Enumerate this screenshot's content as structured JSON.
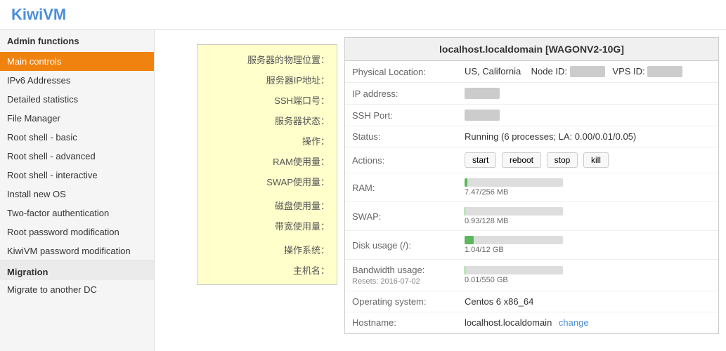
{
  "header": {
    "logo": "KiwiVM"
  },
  "sidebar": {
    "admin_functions_label": "Admin functions",
    "items": [
      {
        "id": "main-controls",
        "label": "Main controls",
        "active": true
      },
      {
        "id": "ipv6-addresses",
        "label": "IPv6 Addresses",
        "active": false
      },
      {
        "id": "detailed-statistics",
        "label": "Detailed statistics",
        "active": false
      },
      {
        "id": "file-manager",
        "label": "File Manager",
        "active": false
      },
      {
        "id": "root-shell-basic",
        "label": "Root shell - basic",
        "active": false
      },
      {
        "id": "root-shell-advanced",
        "label": "Root shell - advanced",
        "active": false
      },
      {
        "id": "root-shell-interactive",
        "label": "Root shell - interactive",
        "active": false
      },
      {
        "id": "install-new-os",
        "label": "Install new OS",
        "active": false
      },
      {
        "id": "two-factor-auth",
        "label": "Two-factor authentication",
        "active": false
      },
      {
        "id": "root-password-mod",
        "label": "Root password modification",
        "active": false
      },
      {
        "id": "kiwivm-password-mod",
        "label": "KiwiVM password modification",
        "active": false
      }
    ],
    "migration_label": "Migration",
    "migration_items": [
      {
        "id": "migrate-dc",
        "label": "Migrate to another DC"
      }
    ]
  },
  "tooltip": {
    "rows": [
      "服务器的物理位置：",
      "服务器IP地址：",
      "SSH端口号：",
      "服务器状态：",
      "操作：",
      "RAM使用量：",
      "SWAP使用量：",
      "磁盘使用量：",
      "带宽使用量：",
      "操作系统：",
      "主机名："
    ]
  },
  "panel": {
    "title": "localhost.localdomain   [WAGONV2-10G]",
    "rows": [
      {
        "label": "Physical Location:",
        "value": "US, California",
        "extra": "Node ID:        VPS ID:"
      },
      {
        "label": "IP address:",
        "value": ""
      },
      {
        "label": "SSH Port:",
        "value": ""
      },
      {
        "label": "Status:",
        "value": "Running (6 processes; LA: 0.00/0.01/0.05)"
      },
      {
        "label": "Actions:",
        "buttons": [
          "start",
          "reboot",
          "stop",
          "kill"
        ]
      },
      {
        "label": "RAM:",
        "progress": {
          "value": 7.47,
          "max": 256,
          "percent": 3,
          "label": "7.47/256 MB"
        }
      },
      {
        "label": "SWAP:",
        "progress": {
          "value": 0.93,
          "max": 128,
          "percent": 1,
          "label": "0.93/128 MB"
        }
      },
      {
        "label": "Disk usage (/):",
        "progress": {
          "value": 1.04,
          "max": 12,
          "percent": 9,
          "label": "1.04/12 GB"
        }
      },
      {
        "label": "Bandwidth usage:",
        "sublabel": "Resets: 2016-07-02",
        "progress": {
          "value": 0.01,
          "max": 550,
          "percent": 1,
          "label": "0.01/550 GB"
        }
      },
      {
        "label": "Operating system:",
        "value": "Centos 6 x86_64"
      },
      {
        "label": "Hostname:",
        "value": "localhost.localdomain",
        "has_change": true
      }
    ],
    "buttons": {
      "start": "start",
      "reboot": "reboot",
      "stop": "stop",
      "kill": "kill"
    },
    "change_label": "change"
  }
}
